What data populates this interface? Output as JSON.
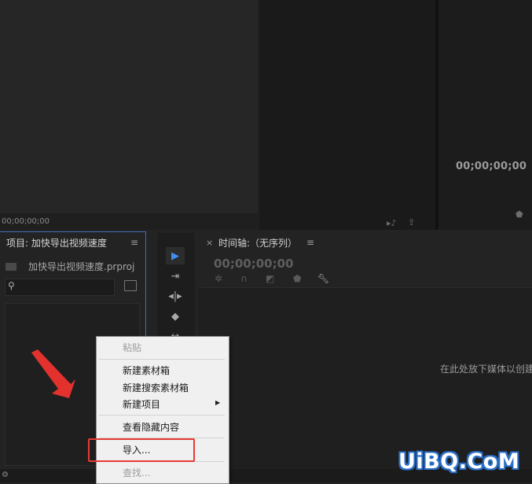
{
  "source_monitor": {
    "timecode": "00;00;00;00"
  },
  "program_monitor": {
    "timecode": "00;00;00;00"
  },
  "project_panel": {
    "tab_title": "项目: 加快导出视频速度",
    "menu_glyph": "≡",
    "project_file": "加快导出视频速度.prproj",
    "search_value": ""
  },
  "timeline_panel": {
    "close_glyph": "×",
    "tab_title": "时间轴:（无序列）",
    "menu_glyph": "≡",
    "timecode": "00;00;00;00",
    "drop_hint": "在此处放下媒体以创建"
  },
  "context_menu": {
    "items": [
      {
        "label": "粘贴",
        "enabled": false
      },
      {
        "label": "新建素材箱",
        "enabled": true
      },
      {
        "label": "新建搜索素材箱",
        "enabled": true
      },
      {
        "label": "新建项目",
        "enabled": true,
        "submenu": true
      },
      {
        "label": "查看隐藏内容",
        "enabled": true
      },
      {
        "label": "导入...",
        "enabled": true,
        "highlighted": true
      },
      {
        "label": "查找...",
        "enabled": false
      }
    ]
  },
  "watermark": "UiBQ.CoM",
  "colors": {
    "selection_blue": "#3d6fb5",
    "highlight_red": "#e83a36",
    "watermark_blue": "#2a6fc8"
  }
}
